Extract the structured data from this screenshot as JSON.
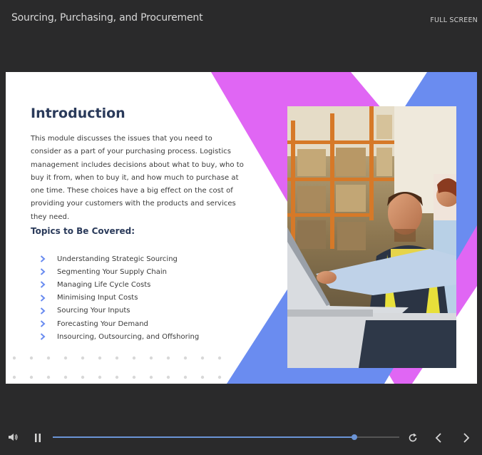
{
  "header": {
    "course_title": "Sourcing, Purchasing, and Procurement",
    "fullscreen_label": "FULL SCREEN"
  },
  "slide": {
    "heading": "Introduction",
    "body": "This module discusses the issues that you need to consider as a part of your purchasing process. Logistics management includes decisions about what to buy, who to buy it from, when to buy it, and how much to purchase at one time. These choices have a big effect on the cost of providing your customers with the products and services they need.",
    "topics_heading": "Topics to Be Covered:",
    "topics": [
      "Understanding Strategic Sourcing",
      "Segmenting Your Supply Chain",
      "Managing Life Cycle Costs",
      "Minimising Input Costs",
      "Sourcing Your Inputs",
      "Forecasting Your Demand",
      "Insourcing, Outsourcing, and Offshoring"
    ],
    "photo_icon": "warehouse-workers-photo",
    "colors": {
      "heading": "#2a3a5a",
      "pink_stripe": "#e066f4",
      "blue_stripe": "#6a8cf0",
      "bullet": "#6a8cf0"
    }
  },
  "player": {
    "volume_icon": "volume-icon",
    "pause_icon": "pause-icon",
    "progress_percent": 87,
    "replay_icon": "replay-icon",
    "prev_icon": "chevron-left-icon",
    "next_icon": "chevron-right-icon",
    "accent": "#6b94d6"
  }
}
